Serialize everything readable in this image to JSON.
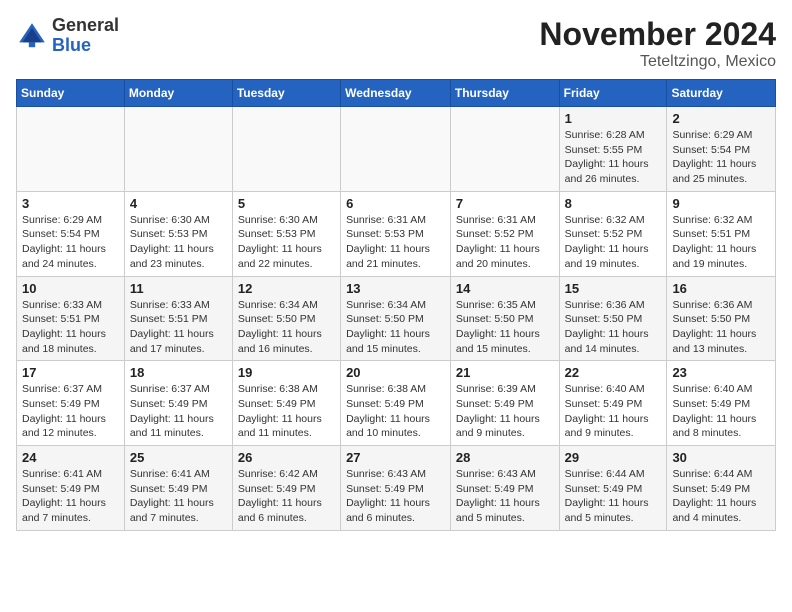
{
  "header": {
    "logo": {
      "general": "General",
      "blue": "Blue"
    },
    "month": "November 2024",
    "location": "Teteltzingo, Mexico"
  },
  "weekdays": [
    "Sunday",
    "Monday",
    "Tuesday",
    "Wednesday",
    "Thursday",
    "Friday",
    "Saturday"
  ],
  "weeks": [
    [
      {
        "day": "",
        "info": ""
      },
      {
        "day": "",
        "info": ""
      },
      {
        "day": "",
        "info": ""
      },
      {
        "day": "",
        "info": ""
      },
      {
        "day": "",
        "info": ""
      },
      {
        "day": "1",
        "info": "Sunrise: 6:28 AM\nSunset: 5:55 PM\nDaylight: 11 hours and 26 minutes."
      },
      {
        "day": "2",
        "info": "Sunrise: 6:29 AM\nSunset: 5:54 PM\nDaylight: 11 hours and 25 minutes."
      }
    ],
    [
      {
        "day": "3",
        "info": "Sunrise: 6:29 AM\nSunset: 5:54 PM\nDaylight: 11 hours and 24 minutes."
      },
      {
        "day": "4",
        "info": "Sunrise: 6:30 AM\nSunset: 5:53 PM\nDaylight: 11 hours and 23 minutes."
      },
      {
        "day": "5",
        "info": "Sunrise: 6:30 AM\nSunset: 5:53 PM\nDaylight: 11 hours and 22 minutes."
      },
      {
        "day": "6",
        "info": "Sunrise: 6:31 AM\nSunset: 5:53 PM\nDaylight: 11 hours and 21 minutes."
      },
      {
        "day": "7",
        "info": "Sunrise: 6:31 AM\nSunset: 5:52 PM\nDaylight: 11 hours and 20 minutes."
      },
      {
        "day": "8",
        "info": "Sunrise: 6:32 AM\nSunset: 5:52 PM\nDaylight: 11 hours and 19 minutes."
      },
      {
        "day": "9",
        "info": "Sunrise: 6:32 AM\nSunset: 5:51 PM\nDaylight: 11 hours and 19 minutes."
      }
    ],
    [
      {
        "day": "10",
        "info": "Sunrise: 6:33 AM\nSunset: 5:51 PM\nDaylight: 11 hours and 18 minutes."
      },
      {
        "day": "11",
        "info": "Sunrise: 6:33 AM\nSunset: 5:51 PM\nDaylight: 11 hours and 17 minutes."
      },
      {
        "day": "12",
        "info": "Sunrise: 6:34 AM\nSunset: 5:50 PM\nDaylight: 11 hours and 16 minutes."
      },
      {
        "day": "13",
        "info": "Sunrise: 6:34 AM\nSunset: 5:50 PM\nDaylight: 11 hours and 15 minutes."
      },
      {
        "day": "14",
        "info": "Sunrise: 6:35 AM\nSunset: 5:50 PM\nDaylight: 11 hours and 15 minutes."
      },
      {
        "day": "15",
        "info": "Sunrise: 6:36 AM\nSunset: 5:50 PM\nDaylight: 11 hours and 14 minutes."
      },
      {
        "day": "16",
        "info": "Sunrise: 6:36 AM\nSunset: 5:50 PM\nDaylight: 11 hours and 13 minutes."
      }
    ],
    [
      {
        "day": "17",
        "info": "Sunrise: 6:37 AM\nSunset: 5:49 PM\nDaylight: 11 hours and 12 minutes."
      },
      {
        "day": "18",
        "info": "Sunrise: 6:37 AM\nSunset: 5:49 PM\nDaylight: 11 hours and 11 minutes."
      },
      {
        "day": "19",
        "info": "Sunrise: 6:38 AM\nSunset: 5:49 PM\nDaylight: 11 hours and 11 minutes."
      },
      {
        "day": "20",
        "info": "Sunrise: 6:38 AM\nSunset: 5:49 PM\nDaylight: 11 hours and 10 minutes."
      },
      {
        "day": "21",
        "info": "Sunrise: 6:39 AM\nSunset: 5:49 PM\nDaylight: 11 hours and 9 minutes."
      },
      {
        "day": "22",
        "info": "Sunrise: 6:40 AM\nSunset: 5:49 PM\nDaylight: 11 hours and 9 minutes."
      },
      {
        "day": "23",
        "info": "Sunrise: 6:40 AM\nSunset: 5:49 PM\nDaylight: 11 hours and 8 minutes."
      }
    ],
    [
      {
        "day": "24",
        "info": "Sunrise: 6:41 AM\nSunset: 5:49 PM\nDaylight: 11 hours and 7 minutes."
      },
      {
        "day": "25",
        "info": "Sunrise: 6:41 AM\nSunset: 5:49 PM\nDaylight: 11 hours and 7 minutes."
      },
      {
        "day": "26",
        "info": "Sunrise: 6:42 AM\nSunset: 5:49 PM\nDaylight: 11 hours and 6 minutes."
      },
      {
        "day": "27",
        "info": "Sunrise: 6:43 AM\nSunset: 5:49 PM\nDaylight: 11 hours and 6 minutes."
      },
      {
        "day": "28",
        "info": "Sunrise: 6:43 AM\nSunset: 5:49 PM\nDaylight: 11 hours and 5 minutes."
      },
      {
        "day": "29",
        "info": "Sunrise: 6:44 AM\nSunset: 5:49 PM\nDaylight: 11 hours and 5 minutes."
      },
      {
        "day": "30",
        "info": "Sunrise: 6:44 AM\nSunset: 5:49 PM\nDaylight: 11 hours and 4 minutes."
      }
    ]
  ]
}
